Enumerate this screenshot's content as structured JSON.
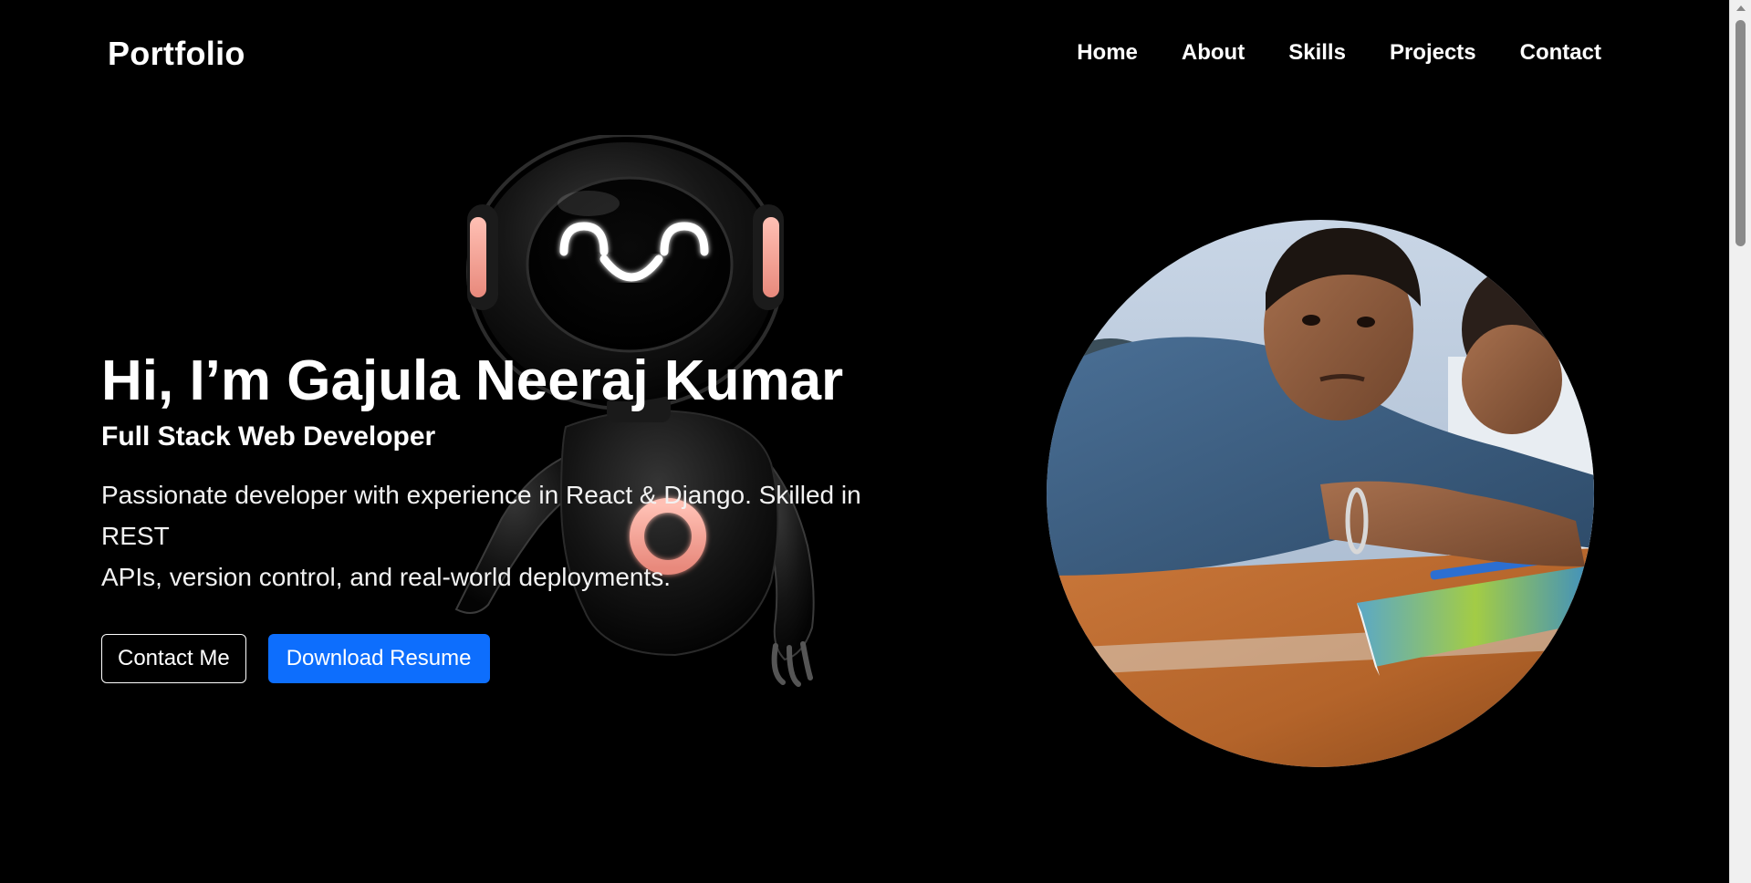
{
  "navbar": {
    "brand": "Portfolio",
    "links": [
      "Home",
      "About",
      "Skills",
      "Projects",
      "Contact"
    ]
  },
  "hero": {
    "title": "Hi, I’m Gajula Neeraj Kumar",
    "subtitle": "Full Stack Web Developer",
    "description_line1": "Passionate developer with experience in React & Django. Skilled in REST",
    "description_line2": "APIs, version control, and real-world deployments.",
    "contact_button": "Contact Me",
    "resume_button": "Download Resume"
  },
  "colors": {
    "background": "#000000",
    "text": "#ffffff",
    "primary_button": "#0d6efd",
    "robot_accent": "#f4a99e"
  },
  "icons": {
    "robot": "robot-illustration",
    "profile": "profile-photo"
  }
}
